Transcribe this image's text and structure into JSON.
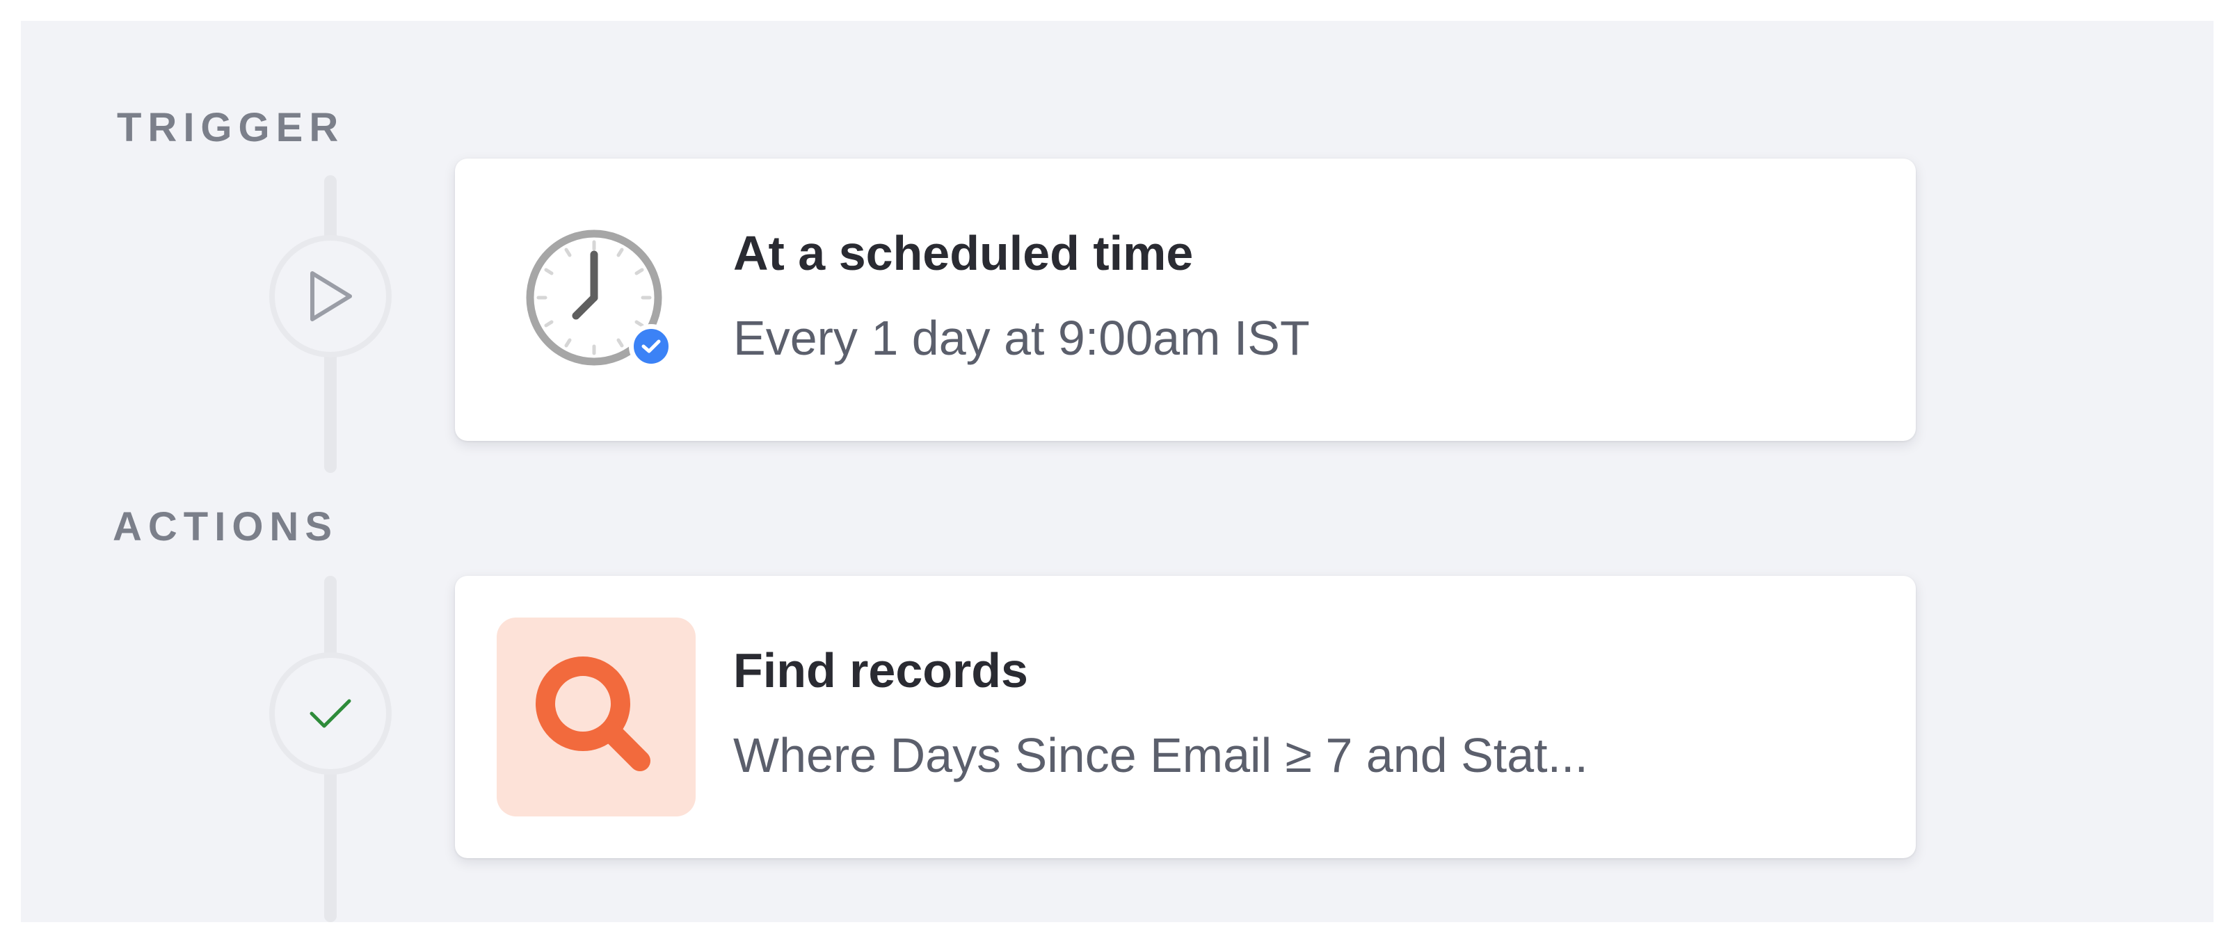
{
  "workflow": {
    "trigger": {
      "section_label": "TRIGGER",
      "node_icon": "play-icon",
      "step": {
        "title": "At a scheduled time",
        "description": "Every 1 day at 9:00am IST",
        "app_icon": "clock-icon",
        "status_badge": "verified-check-icon"
      }
    },
    "actions": {
      "section_label": "ACTIONS",
      "steps": [
        {
          "node_icon": "check-icon",
          "title": "Find records",
          "description": "Where Days Since Email ≥ 7 and Stat...",
          "app_icon": "search-icon"
        }
      ]
    }
  },
  "colors": {
    "canvas_background": "#f2f3f7",
    "section_label": "#7b7f8a",
    "rail": "#e6e7eb",
    "badge": "#3b82f6",
    "search_accent": "#f26a3d",
    "search_icon_background": "#fde2d8",
    "check_mark": "#2e8b3a"
  }
}
